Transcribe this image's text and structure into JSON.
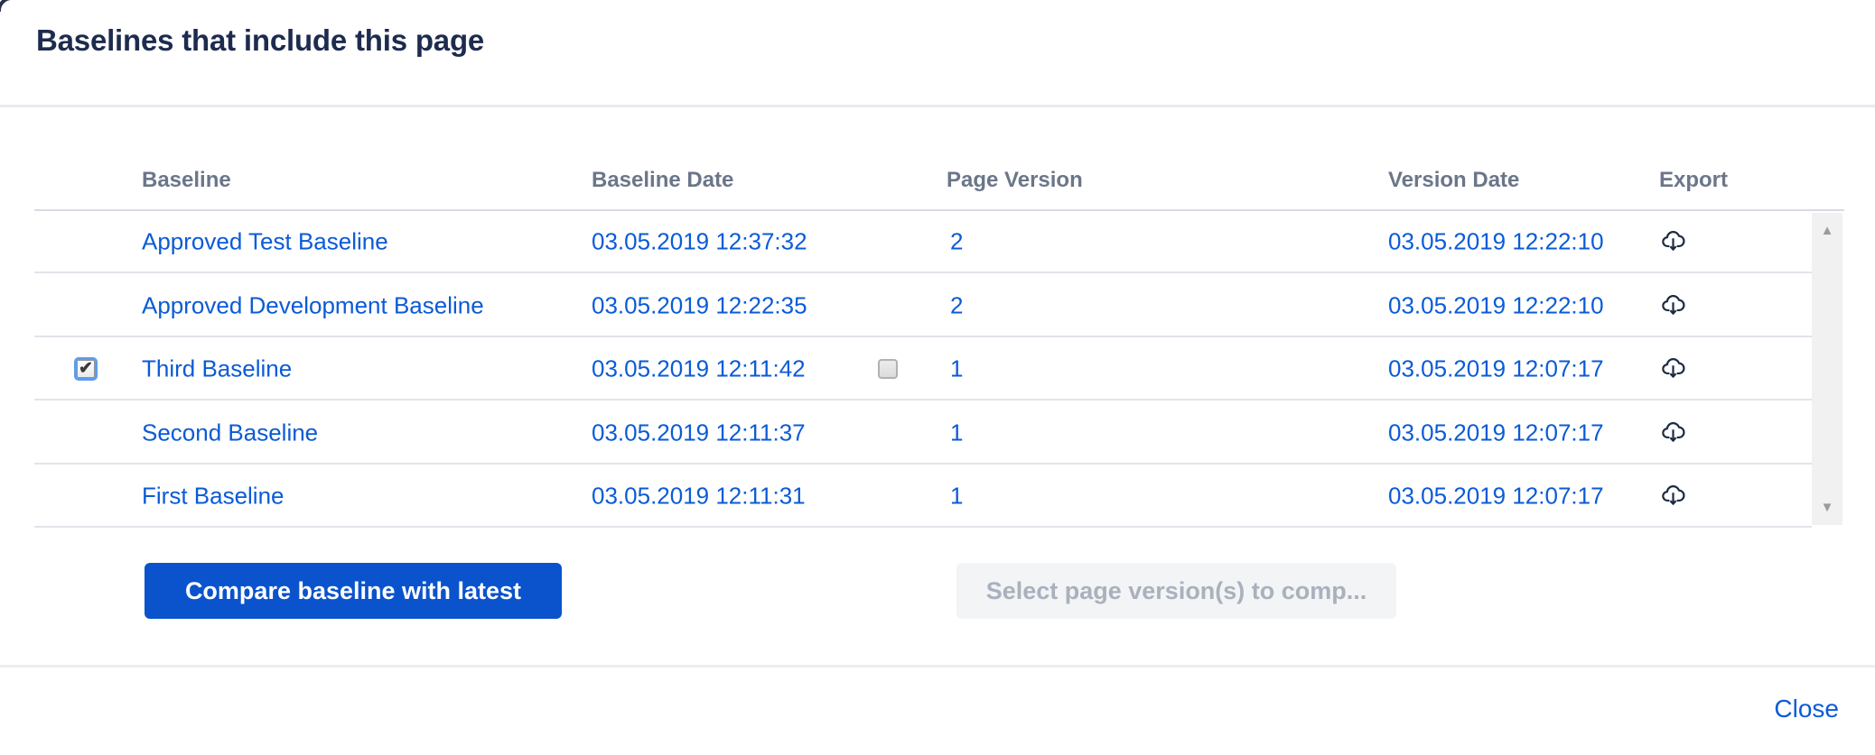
{
  "dialog": {
    "title": "Baselines that include this page",
    "close_label": "Close"
  },
  "table": {
    "headers": {
      "baseline": "Baseline",
      "baseline_date": "Baseline Date",
      "page_version": "Page Version",
      "version_date": "Version Date",
      "export": "Export"
    },
    "rows": [
      {
        "baseline": "Approved Test Baseline",
        "baseline_date": "03.05.2019 12:37:32",
        "page_version": "2",
        "version_date": "03.05.2019 12:22:10",
        "selected": false
      },
      {
        "baseline": "Approved Development Baseline",
        "baseline_date": "03.05.2019 12:22:35",
        "page_version": "2",
        "version_date": "03.05.2019 12:22:10",
        "selected": false
      },
      {
        "baseline": "Third Baseline",
        "baseline_date": "03.05.2019 12:11:42",
        "page_version": "1",
        "version_date": "03.05.2019 12:07:17",
        "selected": true,
        "page_version_checkbox_checked": false
      },
      {
        "baseline": "Second Baseline",
        "baseline_date": "03.05.2019 12:11:37",
        "page_version": "1",
        "version_date": "03.05.2019 12:07:17",
        "selected": false
      },
      {
        "baseline": "First Baseline",
        "baseline_date": "03.05.2019 12:11:31",
        "page_version": "1",
        "version_date": "03.05.2019 12:07:17",
        "selected": false
      }
    ]
  },
  "buttons": {
    "compare_label": "Compare baseline with latest",
    "select_versions_label": "Select page version(s) to comp..."
  },
  "icons": {
    "export": "cloud-download-icon",
    "checkmark": "✔",
    "scroll_up": "▲",
    "scroll_down": "▼"
  },
  "colors": {
    "title_text": "#1d2b4e",
    "header_text": "#6b7689",
    "link": "#0b5bd6",
    "primary_button_bg": "#0a53cc",
    "primary_button_text": "#ffffff",
    "disabled_button_bg": "#f3f4f6",
    "disabled_button_text": "#a9b1bd",
    "divider": "#e2e4ea",
    "divider_strong": "#d8dbe1",
    "scrollbar_track": "#f1f1f1",
    "scrollbar_arrow": "#9b9b9b",
    "icon": "#1d2b41"
  }
}
